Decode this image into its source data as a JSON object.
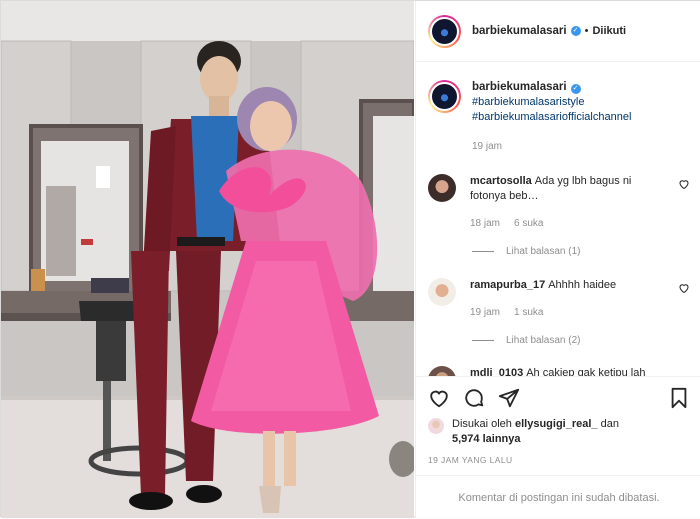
{
  "post": {
    "username": "barbiekumalasari",
    "follow_status": "Diikuti",
    "dot": "•",
    "verified_glyph": "✓"
  },
  "caption": {
    "username": "barbiekumalasari",
    "hashtags": [
      "#barbiekumalasaristyle",
      "#barbiekumalasariofficialchannel"
    ],
    "time": "19 jam"
  },
  "comments": [
    {
      "username": "mcartosolla",
      "text": "Ada yg lbh bagus ni fotonya beb…",
      "time": "18 jam",
      "likes": "6 suka",
      "replies": "Lihat balasan (1)"
    },
    {
      "username": "ramapurba_17",
      "text": "Ahhhh haidee",
      "time": "19 jam",
      "likes": "1 suka",
      "replies": "Lihat balasan (2)"
    },
    {
      "username": "mdli_0103",
      "text": "Ah cakiep gak ketipu lah"
    }
  ],
  "actions": {
    "liked_by_prefix": "Disukai oleh",
    "liked_by_user": "ellysugigi_real_",
    "and_word": "dan",
    "others": "5,974 lainnya",
    "posted_ago": "19 JAM YANG LALU",
    "comments_closed": "Komentar di postingan ini sudah dibatasi."
  },
  "colors": {
    "link": "#00376b",
    "verified": "#3897f0",
    "muted": "#8e8e8e",
    "dress": "#f0549e"
  }
}
